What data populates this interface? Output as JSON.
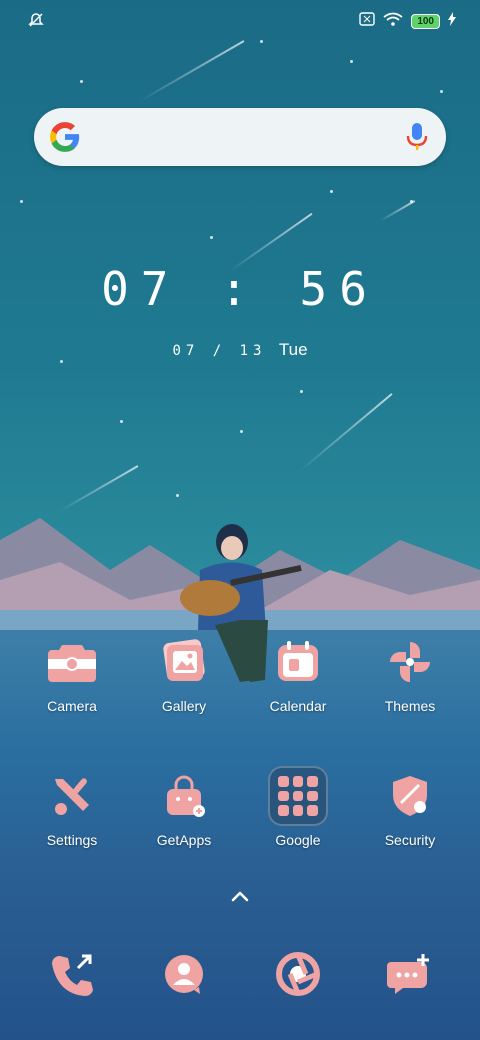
{
  "status": {
    "battery": "100"
  },
  "search": {
    "placeholder": ""
  },
  "clock": {
    "time": "07 : 56",
    "date_numeric": "07 / 13",
    "weekday": "Tue"
  },
  "apps_row1": [
    {
      "label": "Camera"
    },
    {
      "label": "Gallery"
    },
    {
      "label": "Calendar"
    },
    {
      "label": "Themes"
    }
  ],
  "apps_row2": [
    {
      "label": "Settings"
    },
    {
      "label": "GetApps"
    },
    {
      "label": "Google"
    },
    {
      "label": "Security"
    }
  ],
  "dock": [
    {
      "icon": "phone-icon"
    },
    {
      "icon": "contacts-icon"
    },
    {
      "icon": "browser-icon"
    },
    {
      "icon": "messages-icon"
    }
  ],
  "colors": {
    "icon_pink": "#f0a3a3",
    "sky": "#1f7a91",
    "battery_green": "#5fd36a"
  }
}
